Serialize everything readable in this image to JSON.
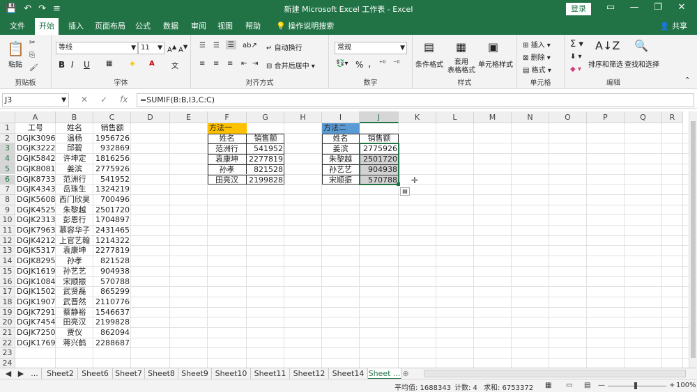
{
  "window": {
    "title": "新建 Microsoft Excel 工作表 - Excel",
    "login_label": "登录",
    "qat": [
      "💾",
      "↶",
      "↷",
      "≡"
    ],
    "controls": [
      "▭",
      "—",
      "❐",
      "✕"
    ]
  },
  "tabs": {
    "items": [
      "文件",
      "开始",
      "插入",
      "页面布局",
      "公式",
      "数据",
      "审阅",
      "视图",
      "帮助"
    ],
    "active": "开始",
    "tell_me": "操作说明搜索",
    "share": "共享"
  },
  "ribbon": {
    "clipboard": {
      "label": "剪贴板",
      "paste": "粘贴"
    },
    "font": {
      "label": "字体",
      "name": "等线",
      "size": "11",
      "bold": "B",
      "italic": "I",
      "underline": "U"
    },
    "alignment": {
      "label": "对齐方式",
      "wrap": "自动换行",
      "merge": "合并后居中"
    },
    "number": {
      "label": "数字",
      "format": "常规",
      "percent": "%",
      "comma": ","
    },
    "styles": {
      "label": "样式",
      "conditional": "条件格式",
      "table": "套用\n表格格式",
      "cell_style": "单元格样式"
    },
    "cells": {
      "label": "单元格",
      "insert": "插入",
      "delete": "删除",
      "format": "格式"
    },
    "editing": {
      "label": "编辑",
      "sort": "排序和筛选",
      "find": "查找和选择"
    }
  },
  "formula_bar": {
    "name_box": "J3",
    "cancel": "✕",
    "enter": "✓",
    "fx": "fx",
    "formula": "=SUMIF(B:B,I3,C:C)"
  },
  "columns": [
    "A",
    "B",
    "C",
    "D",
    "E",
    "F",
    "G",
    "H",
    "I",
    "J",
    "K",
    "L",
    "M",
    "N",
    "O",
    "P",
    "Q",
    "R"
  ],
  "rows": [
    "1",
    "2",
    "3",
    "4",
    "5",
    "6",
    "7",
    "8",
    "9",
    "10",
    "11",
    "12",
    "13",
    "14",
    "15",
    "16",
    "17",
    "18",
    "19",
    "20",
    "21",
    "22",
    "23",
    "24"
  ],
  "main_table": {
    "headers": [
      "工号",
      "姓名",
      "销售额"
    ],
    "rows": [
      [
        "DGJK3096",
        "温杨",
        "1956726"
      ],
      [
        "DGJK3222",
        "邱碧",
        "932869"
      ],
      [
        "DGJK5842",
        "许坤定",
        "1816256"
      ],
      [
        "DGJK8081",
        "姜滨",
        "2775926"
      ],
      [
        "DGJK8733",
        "范洲行",
        "541952"
      ],
      [
        "DGJK4343",
        "岳珠生",
        "1324219"
      ],
      [
        "DGJK5608",
        "西门欣昊",
        "700496"
      ],
      [
        "DGJK4525",
        "朱黎越",
        "2501720"
      ],
      [
        "DGJK2313",
        "彭恩行",
        "1704897"
      ],
      [
        "DGJK7963",
        "慕容华子",
        "2431465"
      ],
      [
        "DGJK4212",
        "上官艺翰",
        "1214322"
      ],
      [
        "DGJK5317",
        "袁康坤",
        "2277819"
      ],
      [
        "DGJK8295",
        "孙孝",
        "821528"
      ],
      [
        "DGJK1619",
        "孙艺艺",
        "904938"
      ],
      [
        "DGJK1084",
        "宋顺振",
        "570788"
      ],
      [
        "DGJK1502",
        "武贤磊",
        "865299"
      ],
      [
        "DGJK1907",
        "武晋然",
        "2110776"
      ],
      [
        "DGJK7291",
        "蔡静裕",
        "1546637"
      ],
      [
        "DGJK7454",
        "田亮汉",
        "2199828"
      ],
      [
        "DGJK7250",
        "贾仪",
        "862094"
      ],
      [
        "DGJK1769",
        "蒋兴鹤",
        "2288687"
      ]
    ]
  },
  "method1": {
    "title": "方法一",
    "headers": [
      "姓名",
      "销售额"
    ],
    "rows": [
      [
        "范洲行",
        "541952"
      ],
      [
        "袁康坤",
        "2277819"
      ],
      [
        "孙孝",
        "821528"
      ],
      [
        "田亮汉",
        "2199828"
      ]
    ]
  },
  "method2": {
    "title": "方法二",
    "headers": [
      "姓名",
      "销售额"
    ],
    "rows": [
      [
        "姜滨",
        "2775926"
      ],
      [
        "朱黎越",
        "2501720"
      ],
      [
        "孙艺艺",
        "904938"
      ],
      [
        "宋顺振",
        "570788"
      ]
    ]
  },
  "sheets": {
    "items": [
      "Sheet2",
      "Sheet6",
      "Sheet7",
      "Sheet8",
      "Sheet9",
      "Sheet10",
      "Sheet11",
      "Sheet12",
      "Sheet14",
      "Sheet ..."
    ],
    "active": "Sheet ...",
    "nav": [
      "◀",
      "▶",
      "..."
    ],
    "add": "⊕"
  },
  "status": {
    "average": "平均值: 1688343",
    "count": "计数: 4",
    "sum": "求和: 6753372",
    "zoom": "100%"
  },
  "colors": {
    "accent": "#217346",
    "method1_fill": "#ffc000",
    "method2_fill": "#5b9bd5"
  }
}
